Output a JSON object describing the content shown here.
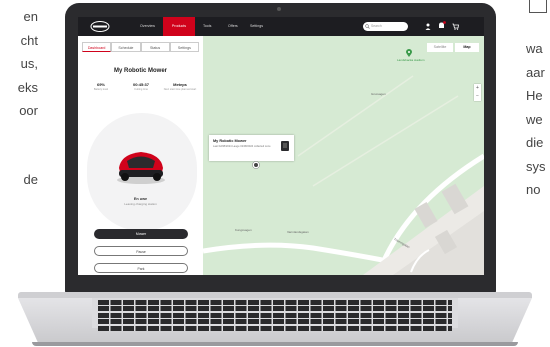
{
  "side_text": {
    "left": [
      "en",
      "cht",
      "us,",
      "eks",
      "oor",
      "de"
    ],
    "right": [
      "wa",
      "aar",
      "He",
      "we",
      "die",
      "sys",
      "no"
    ]
  },
  "nav": {
    "items": [
      "Overview",
      "Products",
      "Tools",
      "Offers",
      "Settings"
    ],
    "active": "Products",
    "search_placeholder": "Search"
  },
  "panel": {
    "tabs": [
      "Dashboard",
      "Schedule",
      "Status",
      "Settings"
    ],
    "active_tab": "Dashboard",
    "title": "My Robotic Mower",
    "stats": [
      {
        "value": "69%",
        "label": "Battery level"
      },
      {
        "value": "00:45:37",
        "label": "Cutting time"
      },
      {
        "value": "Meteps",
        "label": "Next start time planned start"
      }
    ],
    "status": "En uwe",
    "substatus": "Leaving charging station",
    "buttons": [
      "Mower",
      "Pause",
      "Park"
    ]
  },
  "map": {
    "toggle": [
      "Satellite",
      "Map"
    ],
    "active_toggle": "Map",
    "popup_title": "My Robotic Mower",
    "popup_text": "Last 02/08/2024 Lauge 02/08/2024 collected once",
    "labels": [
      "Landsbacka stadium",
      "Grusvagen",
      "Kungsvagen",
      "Varmlandsgatan",
      "Traumsgatan"
    ],
    "zoom_in": "+",
    "zoom_out": "−"
  },
  "colors": {
    "brand": "#d0021b",
    "header": "#1d1d21",
    "map": "#d6ead3"
  }
}
